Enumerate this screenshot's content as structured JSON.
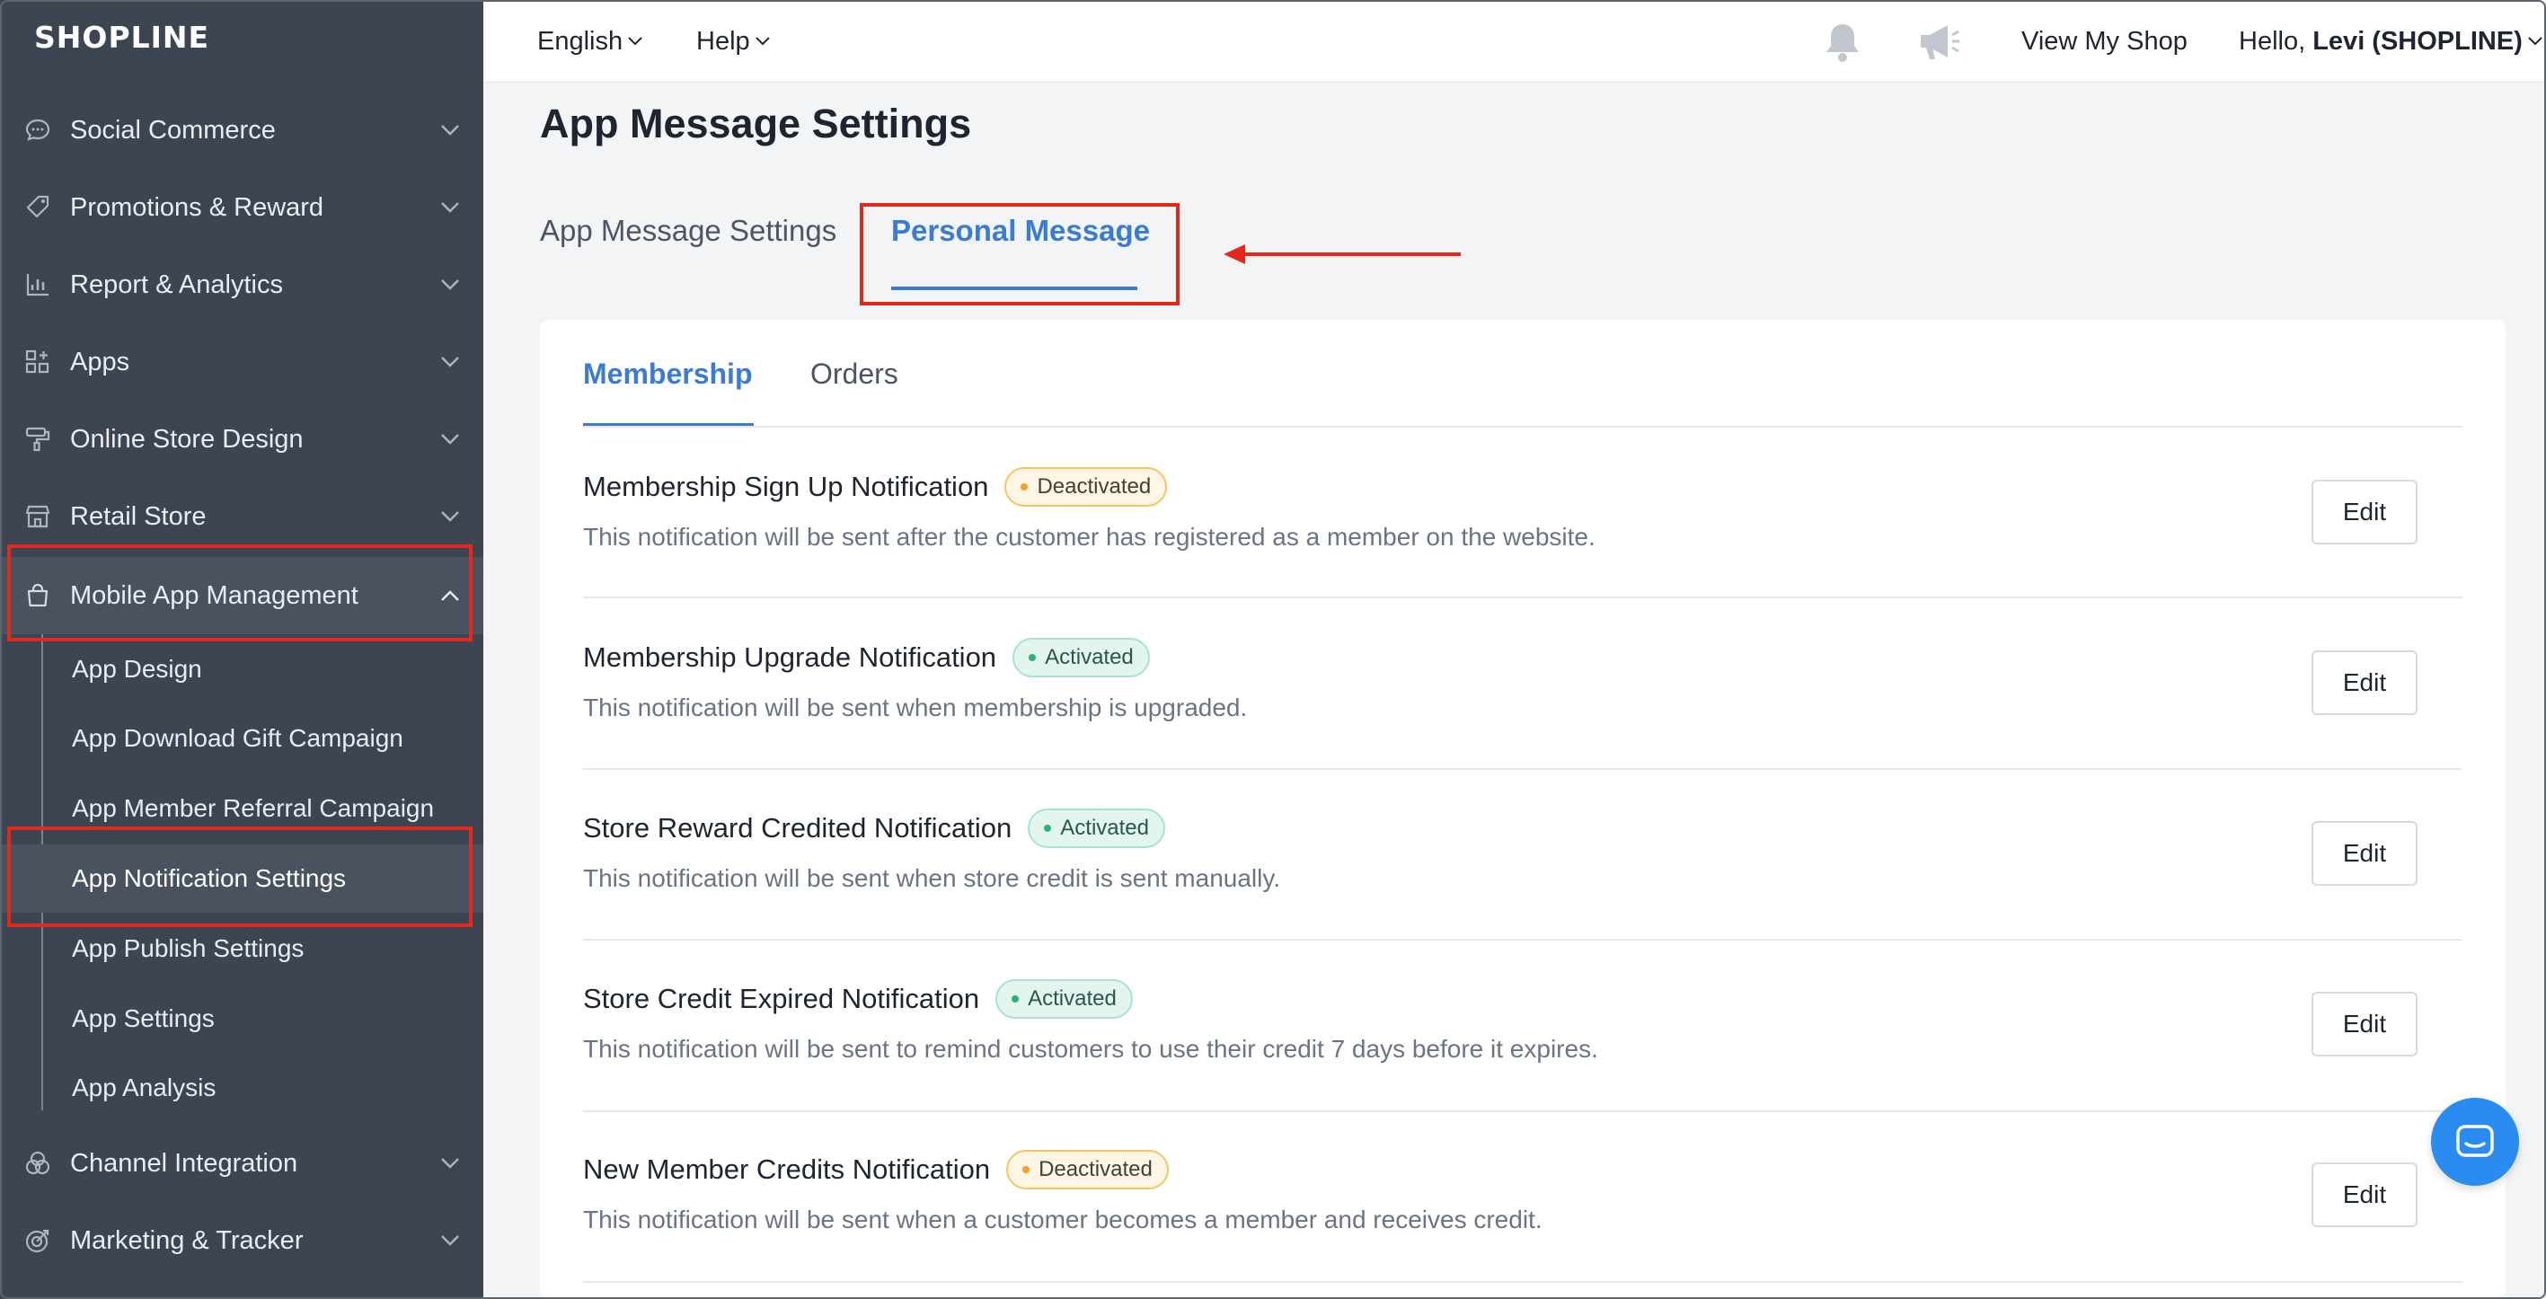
{
  "brand": {
    "logo": "SHOPLINE"
  },
  "sidebar": {
    "items": [
      {
        "label": "Social Commerce",
        "icon": "chat-bubble-icon"
      },
      {
        "label": "Promotions & Reward",
        "icon": "tag-icon"
      },
      {
        "label": "Report & Analytics",
        "icon": "bar-chart-icon"
      },
      {
        "label": "Apps",
        "icon": "apps-grid-icon"
      },
      {
        "label": "Online Store Design",
        "icon": "paint-roller-icon"
      },
      {
        "label": "Retail Store",
        "icon": "store-icon"
      },
      {
        "label": "Mobile App Management",
        "icon": "shopping-bag-icon",
        "expanded": true
      },
      {
        "label": "Channel Integration",
        "icon": "channels-icon"
      },
      {
        "label": "Marketing & Tracker",
        "icon": "target-icon"
      }
    ],
    "sub_items": [
      {
        "label": "App Design"
      },
      {
        "label": "App Download Gift Campaign"
      },
      {
        "label": "App Member Referral Campaign"
      },
      {
        "label": "App Notification Settings",
        "active": true
      },
      {
        "label": "App Publish Settings"
      },
      {
        "label": "App Settings"
      },
      {
        "label": "App Analysis"
      }
    ]
  },
  "topbar": {
    "language": "English",
    "help": "Help",
    "view_shop": "View My Shop",
    "greeting": "Hello,",
    "user": "Levi (SHOPLINE)"
  },
  "page": {
    "title": "App Message Settings",
    "tabs": [
      {
        "label": "App Message Settings"
      },
      {
        "label": "Personal Message",
        "active": true
      }
    ],
    "sub_tabs": [
      {
        "label": "Membership",
        "active": true
      },
      {
        "label": "Orders"
      }
    ]
  },
  "notifications": [
    {
      "title": "Membership Sign Up Notification",
      "status": "Deactivated",
      "desc": "This notification will be sent after the customer has registered as a member on the website.",
      "action": "Edit"
    },
    {
      "title": "Membership Upgrade Notification",
      "status": "Activated",
      "desc": "This notification will be sent when membership is upgraded.",
      "action": "Edit"
    },
    {
      "title": "Store Reward Credited Notification",
      "status": "Activated",
      "desc": "This notification will be sent when store credit is sent manually.",
      "action": "Edit"
    },
    {
      "title": "Store Credit Expired Notification",
      "status": "Activated",
      "desc": "This notification will be sent to remind customers to use their credit 7 days before it expires.",
      "action": "Edit"
    },
    {
      "title": "New Member Credits Notification",
      "status": "Deactivated",
      "desc": "This notification will be sent when a customer becomes a member and receives credit.",
      "action": "Edit"
    }
  ],
  "colors": {
    "sidebar_bg": "#3d4553",
    "accent": "#3a7bd5",
    "annotation_red": "#e4281c",
    "chat_button": "#2a8cf0"
  }
}
